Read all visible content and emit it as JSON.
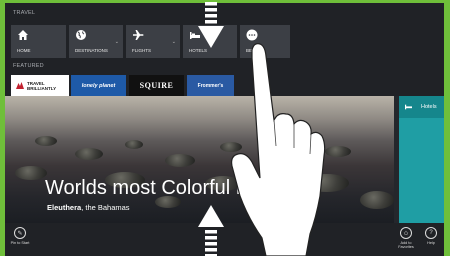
{
  "nav": {
    "section_travel": "TRAVEL",
    "section_featured": "FEATURED",
    "tiles": [
      {
        "label": "HOME",
        "icon": "home-icon"
      },
      {
        "label": "DESTINATIONS",
        "icon": "globe-icon"
      },
      {
        "label": "FLIGHTS",
        "icon": "airplane-icon"
      },
      {
        "label": "HOTELS",
        "icon": "bed-icon"
      },
      {
        "label": "BEST",
        "icon": "more-icon"
      }
    ],
    "featured": [
      {
        "label": "TRAVEL BRILLIANTLY"
      },
      {
        "label": "lonely planet"
      },
      {
        "label": "SQUIRE"
      },
      {
        "label": "Frommer's"
      }
    ]
  },
  "hero": {
    "title": "Worlds most Colorful Bea",
    "location_bold": "Eleuthera",
    "location_rest": ", the Bahamas"
  },
  "side_panel": {
    "label": "Hotels"
  },
  "app_bar": {
    "pin": "Pin to Start",
    "favorites": "Add to Favorites",
    "help": "Help"
  },
  "colors": {
    "accent_green": "#6fbf3a",
    "panel_teal": "#1f9ea4"
  }
}
